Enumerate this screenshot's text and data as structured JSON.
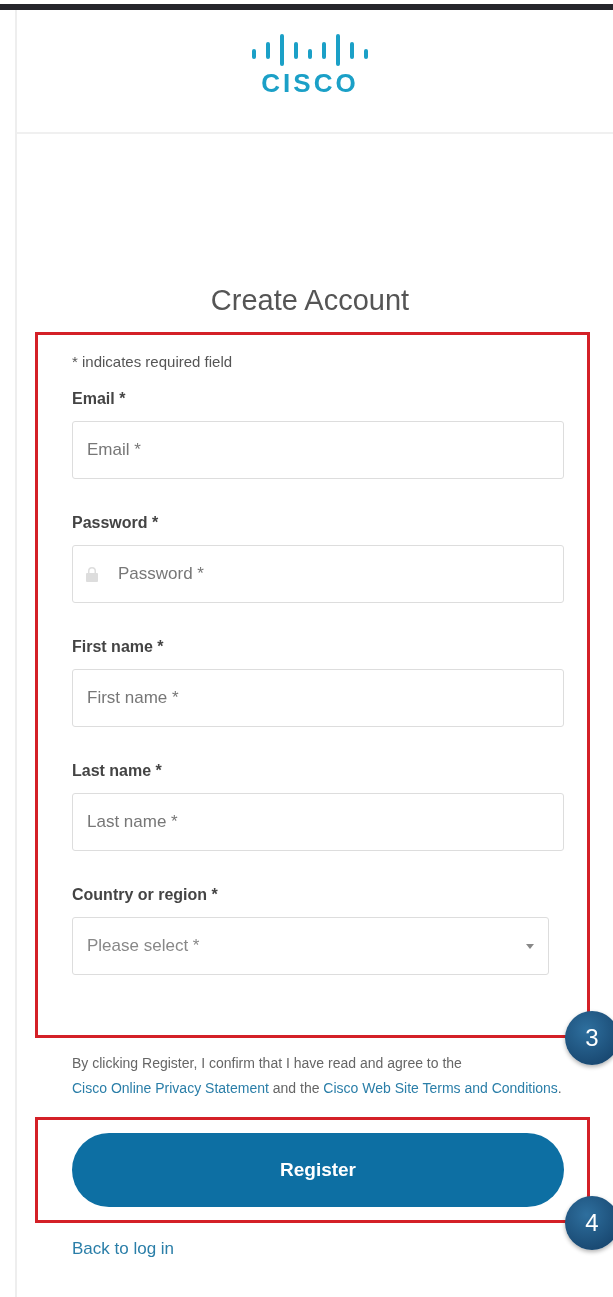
{
  "logo": {
    "text": "CISCO"
  },
  "title": "Create Account",
  "form": {
    "note": "* indicates required field",
    "fields": [
      {
        "kind": "text",
        "label": "Email *",
        "placeholder": "Email *"
      },
      {
        "kind": "password",
        "label": "Password *",
        "placeholder": "Password *"
      },
      {
        "kind": "text",
        "label": "First name *",
        "placeholder": "First name *"
      },
      {
        "kind": "text",
        "label": "Last name *",
        "placeholder": "Last name *"
      },
      {
        "kind": "select",
        "label": "Country or region *",
        "placeholder": "Please select *"
      }
    ],
    "callout": "3"
  },
  "terms": [
    {
      "kind": "text",
      "text": "By clicking Register, I confirm that I have read and agree to the "
    },
    {
      "kind": "link",
      "text": "Cisco Online Privacy Statement"
    },
    {
      "kind": "text",
      "text": " and the "
    },
    {
      "kind": "link",
      "text": "Cisco Web Site Terms and Conditions"
    },
    {
      "kind": "text",
      "text": "."
    }
  ],
  "register": {
    "label": "Register",
    "callout": "4"
  },
  "back_link": "Back to log in"
}
